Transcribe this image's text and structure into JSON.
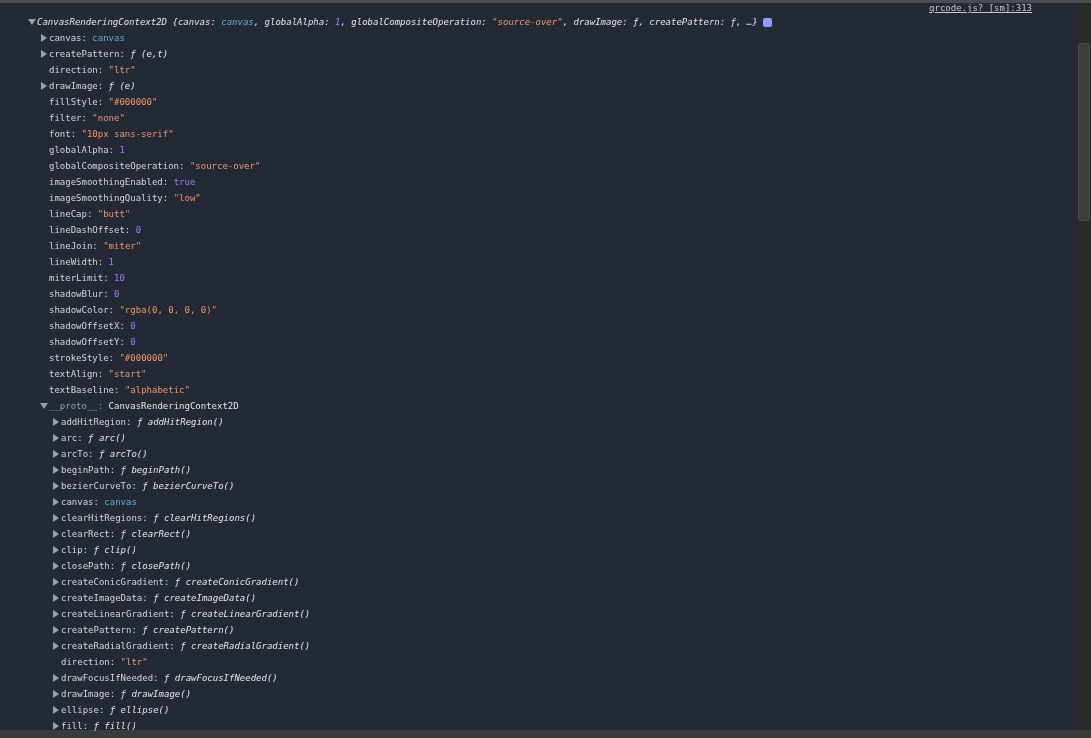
{
  "source_link": "qrcode.js?_[sm]:313",
  "root": {
    "expanded": true,
    "summary": [
      {
        "text": "CanvasRenderingContext2D {",
        "kind": "plain"
      },
      {
        "text": "canvas: ",
        "kind": "plain"
      },
      {
        "text": "canvas",
        "kind": "object"
      },
      {
        "text": ", globalAlpha: ",
        "kind": "plain"
      },
      {
        "text": "1",
        "kind": "number"
      },
      {
        "text": ", globalCompositeOperation: ",
        "kind": "plain"
      },
      {
        "text": "\"source-over\"",
        "kind": "string"
      },
      {
        "text": ", drawImage: ƒ, createPattern: ƒ, …}",
        "kind": "plain"
      }
    ],
    "children": [
      {
        "key": "canvas:",
        "value": "canvas",
        "kind": "object",
        "expandable": true,
        "expanded": false
      },
      {
        "key": "createPattern:",
        "value": "ƒ (e,t)",
        "kind": "function",
        "expandable": true,
        "expanded": false
      },
      {
        "key": "direction:",
        "value": "\"ltr\"",
        "kind": "string",
        "expandable": false
      },
      {
        "key": "drawImage:",
        "value": "ƒ (e)",
        "kind": "function",
        "expandable": true,
        "expanded": false
      },
      {
        "key": "fillStyle:",
        "value": "\"#000000\"",
        "kind": "string",
        "expandable": false
      },
      {
        "key": "filter:",
        "value": "\"none\"",
        "kind": "string",
        "expandable": false
      },
      {
        "key": "font:",
        "value": "\"10px sans-serif\"",
        "kind": "string",
        "expandable": false
      },
      {
        "key": "globalAlpha:",
        "value": "1",
        "kind": "number",
        "expandable": false
      },
      {
        "key": "globalCompositeOperation:",
        "value": "\"source-over\"",
        "kind": "string",
        "expandable": false
      },
      {
        "key": "imageSmoothingEnabled:",
        "value": "true",
        "kind": "number",
        "expandable": false
      },
      {
        "key": "imageSmoothingQuality:",
        "value": "\"low\"",
        "kind": "string",
        "expandable": false
      },
      {
        "key": "lineCap:",
        "value": "\"butt\"",
        "kind": "string",
        "expandable": false
      },
      {
        "key": "lineDashOffset:",
        "value": "0",
        "kind": "number",
        "expandable": false
      },
      {
        "key": "lineJoin:",
        "value": "\"miter\"",
        "kind": "string",
        "expandable": false
      },
      {
        "key": "lineWidth:",
        "value": "1",
        "kind": "number",
        "expandable": false
      },
      {
        "key": "miterLimit:",
        "value": "10",
        "kind": "number",
        "expandable": false
      },
      {
        "key": "shadowBlur:",
        "value": "0",
        "kind": "number",
        "expandable": false
      },
      {
        "key": "shadowColor:",
        "value": "\"rgba(0, 0, 0, 0)\"",
        "kind": "string",
        "expandable": false
      },
      {
        "key": "shadowOffsetX:",
        "value": "0",
        "kind": "number",
        "expandable": false
      },
      {
        "key": "shadowOffsetY:",
        "value": "0",
        "kind": "number",
        "expandable": false
      },
      {
        "key": "strokeStyle:",
        "value": "\"#000000\"",
        "kind": "string",
        "expandable": false
      },
      {
        "key": "textAlign:",
        "value": "\"start\"",
        "kind": "string",
        "expandable": false
      },
      {
        "key": "textBaseline:",
        "value": "\"alphabetic\"",
        "kind": "string",
        "expandable": false
      },
      {
        "key": "__proto__:",
        "value": "CanvasRenderingContext2D",
        "kind": "plain",
        "expandable": true,
        "expanded": true,
        "children": [
          {
            "key": "addHitRegion:",
            "value": "ƒ addHitRegion()",
            "kind": "function",
            "expandable": true,
            "expanded": false
          },
          {
            "key": "arc:",
            "value": "ƒ arc()",
            "kind": "function",
            "expandable": true,
            "expanded": false
          },
          {
            "key": "arcTo:",
            "value": "ƒ arcTo()",
            "kind": "function",
            "expandable": true,
            "expanded": false
          },
          {
            "key": "beginPath:",
            "value": "ƒ beginPath()",
            "kind": "function",
            "expandable": true,
            "expanded": false
          },
          {
            "key": "bezierCurveTo:",
            "value": "ƒ bezierCurveTo()",
            "kind": "function",
            "expandable": true,
            "expanded": false
          },
          {
            "key": "canvas:",
            "value": "canvas",
            "kind": "object",
            "expandable": true,
            "expanded": false
          },
          {
            "key": "clearHitRegions:",
            "value": "ƒ clearHitRegions()",
            "kind": "function",
            "expandable": true,
            "expanded": false
          },
          {
            "key": "clearRect:",
            "value": "ƒ clearRect()",
            "kind": "function",
            "expandable": true,
            "expanded": false
          },
          {
            "key": "clip:",
            "value": "ƒ clip()",
            "kind": "function",
            "expandable": true,
            "expanded": false
          },
          {
            "key": "closePath:",
            "value": "ƒ closePath()",
            "kind": "function",
            "expandable": true,
            "expanded": false
          },
          {
            "key": "createConicGradient:",
            "value": "ƒ createConicGradient()",
            "kind": "function",
            "expandable": true,
            "expanded": false
          },
          {
            "key": "createImageData:",
            "value": "ƒ createImageData()",
            "kind": "function",
            "expandable": true,
            "expanded": false
          },
          {
            "key": "createLinearGradient:",
            "value": "ƒ createLinearGradient()",
            "kind": "function",
            "expandable": true,
            "expanded": false
          },
          {
            "key": "createPattern:",
            "value": "ƒ createPattern()",
            "kind": "function",
            "expandable": true,
            "expanded": false
          },
          {
            "key": "createRadialGradient:",
            "value": "ƒ createRadialGradient()",
            "kind": "function",
            "expandable": true,
            "expanded": false
          },
          {
            "key": "direction:",
            "value": "\"ltr\"",
            "kind": "string",
            "expandable": false
          },
          {
            "key": "drawFocusIfNeeded:",
            "value": "ƒ drawFocusIfNeeded()",
            "kind": "function",
            "expandable": true,
            "expanded": false
          },
          {
            "key": "drawImage:",
            "value": "ƒ drawImage()",
            "kind": "function",
            "expandable": true,
            "expanded": false
          },
          {
            "key": "ellipse:",
            "value": "ƒ ellipse()",
            "kind": "function",
            "expandable": true,
            "expanded": false
          },
          {
            "key": "fill:",
            "value": "ƒ fill()",
            "kind": "function",
            "expandable": true,
            "expanded": false
          }
        ]
      }
    ]
  }
}
